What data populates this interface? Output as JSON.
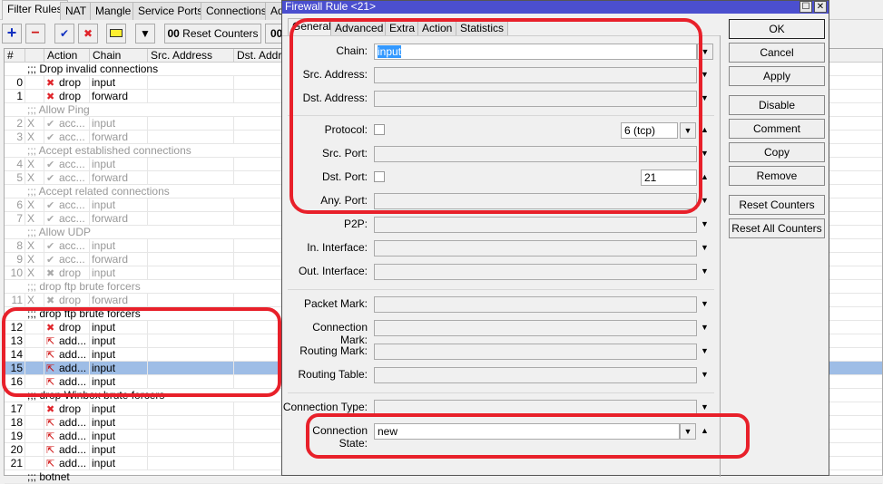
{
  "tabs": [
    "Filter Rules",
    "NAT",
    "Mangle",
    "Service Ports",
    "Connections",
    "Ad"
  ],
  "toolbar": {
    "add": "+",
    "remove": "−",
    "enable": "✔",
    "disable": "✖",
    "comment": "▭",
    "filter": "▼",
    "reset_counters": "Reset Counters",
    "reset_all_prefix": "00",
    "counter_prefix": "00"
  },
  "columns": [
    "#",
    "",
    "Action",
    "Chain",
    "Src. Address",
    "Dst. Address"
  ],
  "rows": [
    {
      "type": "comment",
      "text": ";;; Drop invalid connections",
      "disabled": false
    },
    {
      "num": "0",
      "flag": "",
      "action": "drop",
      "icon": "drop",
      "chain": "input",
      "disabled": false
    },
    {
      "num": "1",
      "flag": "",
      "action": "drop",
      "icon": "drop",
      "chain": "forward",
      "disabled": false
    },
    {
      "type": "comment",
      "text": ";;; Allow Ping",
      "disabled": true
    },
    {
      "num": "2",
      "flag": "X",
      "action": "acc...",
      "icon": "accept",
      "chain": "input",
      "disabled": true
    },
    {
      "num": "3",
      "flag": "X",
      "action": "acc...",
      "icon": "accept",
      "chain": "forward",
      "disabled": true
    },
    {
      "type": "comment",
      "text": ";;; Accept established connections",
      "disabled": true
    },
    {
      "num": "4",
      "flag": "X",
      "action": "acc...",
      "icon": "accept",
      "chain": "input",
      "disabled": true
    },
    {
      "num": "5",
      "flag": "X",
      "action": "acc...",
      "icon": "accept",
      "chain": "forward",
      "disabled": true
    },
    {
      "type": "comment",
      "text": ";;; Accept related connections",
      "disabled": true
    },
    {
      "num": "6",
      "flag": "X",
      "action": "acc...",
      "icon": "accept",
      "chain": "input",
      "disabled": true
    },
    {
      "num": "7",
      "flag": "X",
      "action": "acc...",
      "icon": "accept",
      "chain": "forward",
      "disabled": true
    },
    {
      "type": "comment",
      "text": ";;; Allow UDP",
      "disabled": true
    },
    {
      "num": "8",
      "flag": "X",
      "action": "acc...",
      "icon": "accept",
      "chain": "input",
      "disabled": true
    },
    {
      "num": "9",
      "flag": "X",
      "action": "acc...",
      "icon": "accept",
      "chain": "forward",
      "disabled": true
    },
    {
      "num": "10",
      "flag": "X",
      "action": "drop",
      "icon": "drop",
      "chain": "input",
      "disabled": true
    },
    {
      "type": "comment",
      "text": ";;; drop ftp brute forcers",
      "disabled": true
    },
    {
      "num": "11",
      "flag": "X",
      "action": "drop",
      "icon": "drop",
      "chain": "forward",
      "disabled": true
    },
    {
      "type": "comment",
      "text": ";;; drop ftp brute forcers",
      "disabled": false
    },
    {
      "num": "12",
      "flag": "",
      "action": "drop",
      "icon": "drop",
      "chain": "input",
      "disabled": false
    },
    {
      "num": "13",
      "flag": "",
      "action": "add...",
      "icon": "add",
      "chain": "input",
      "disabled": false
    },
    {
      "num": "14",
      "flag": "",
      "action": "add...",
      "icon": "add",
      "chain": "input",
      "disabled": false
    },
    {
      "num": "15",
      "flag": "",
      "action": "add...",
      "icon": "add",
      "chain": "input",
      "disabled": false,
      "selected": true
    },
    {
      "num": "16",
      "flag": "",
      "action": "add...",
      "icon": "add",
      "chain": "input",
      "disabled": false
    },
    {
      "type": "comment",
      "text": ";;; drop Winbox brute forcers",
      "disabled": false
    },
    {
      "num": "17",
      "flag": "",
      "action": "drop",
      "icon": "drop",
      "chain": "input",
      "disabled": false
    },
    {
      "num": "18",
      "flag": "",
      "action": "add...",
      "icon": "add",
      "chain": "input",
      "disabled": false
    },
    {
      "num": "19",
      "flag": "",
      "action": "add...",
      "icon": "add",
      "chain": "input",
      "disabled": false
    },
    {
      "num": "20",
      "flag": "",
      "action": "add...",
      "icon": "add",
      "chain": "input",
      "disabled": false
    },
    {
      "num": "21",
      "flag": "",
      "action": "add...",
      "icon": "add",
      "chain": "input",
      "disabled": false
    },
    {
      "type": "comment",
      "text": ";;; botnet",
      "disabled": false
    }
  ],
  "dialog": {
    "title": "Firewall Rule <21>",
    "tabs": [
      "General",
      "Advanced",
      "Extra",
      "Action",
      "Statistics"
    ],
    "fields": {
      "chain": {
        "label": "Chain:",
        "value": "input"
      },
      "src_address": {
        "label": "Src. Address:",
        "value": ""
      },
      "dst_address": {
        "label": "Dst. Address:",
        "value": ""
      },
      "protocol": {
        "label": "Protocol:",
        "value": "6 (tcp)",
        "negate": false
      },
      "src_port": {
        "label": "Src. Port:",
        "value": ""
      },
      "dst_port": {
        "label": "Dst. Port:",
        "value": "21",
        "negate": false
      },
      "any_port": {
        "label": "Any. Port:",
        "value": ""
      },
      "p2p": {
        "label": "P2P:",
        "value": ""
      },
      "in_interface": {
        "label": "In. Interface:",
        "value": ""
      },
      "out_interface": {
        "label": "Out. Interface:",
        "value": ""
      },
      "packet_mark": {
        "label": "Packet Mark:",
        "value": ""
      },
      "connection_mark": {
        "label": "Connection Mark:",
        "value": ""
      },
      "routing_mark": {
        "label": "Routing Mark:",
        "value": ""
      },
      "routing_table": {
        "label": "Routing Table:",
        "value": ""
      },
      "connection_type": {
        "label": "Connection Type:",
        "value": ""
      },
      "connection_state": {
        "label": "Connection State:",
        "value": "new"
      }
    },
    "buttons": {
      "ok": "OK",
      "cancel": "Cancel",
      "apply": "Apply",
      "disable": "Disable",
      "comment": "Comment",
      "copy": "Copy",
      "remove": "Remove",
      "reset_counters": "Reset Counters",
      "reset_all_counters": "Reset All Counters"
    }
  },
  "colors": {
    "title_bar": "#4b4fcf",
    "selection": "#9ebde6",
    "annotation": "#e8202a",
    "drop_icon": "#e0242a"
  }
}
